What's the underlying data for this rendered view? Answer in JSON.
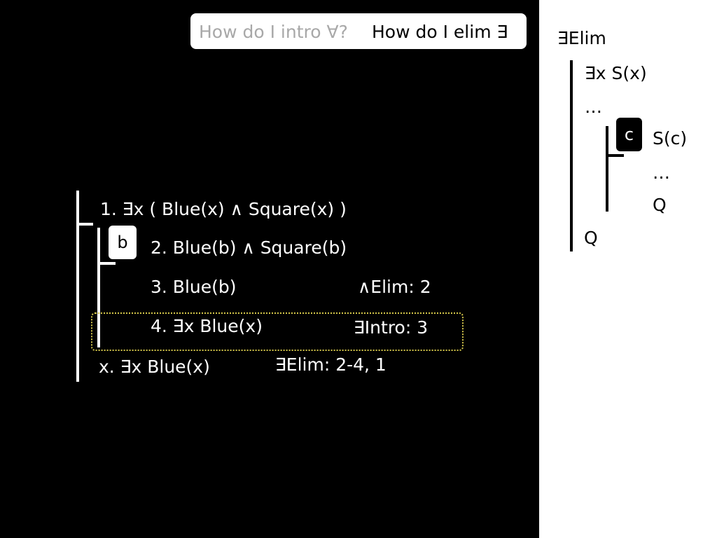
{
  "question": {
    "intro": "How do I intro ∀?",
    "elim": "How do I elim ∃"
  },
  "proof": {
    "premise": "1. ∃x ( Blue(x) ∧ Square(x) )",
    "flag": "b",
    "lines": [
      {
        "formula": "2. Blue(b) ∧ Square(b)",
        "justification": ""
      },
      {
        "formula": "3. Blue(b)",
        "justification": "∧Elim: 2"
      },
      {
        "formula": "4. ∃x Blue(x)",
        "justification": "∃Intro: 3"
      }
    ],
    "conclusion": {
      "formula": "x. ∃x Blue(x)",
      "justification": "∃Elim: 2-4, 1"
    }
  },
  "rule_reference": {
    "title": "∃Elim",
    "outer_lines": [
      "∃x S(x)",
      "…"
    ],
    "flag": "c",
    "inner_lines": [
      "S(c)",
      "…",
      "Q"
    ],
    "conclusion": "Q"
  }
}
